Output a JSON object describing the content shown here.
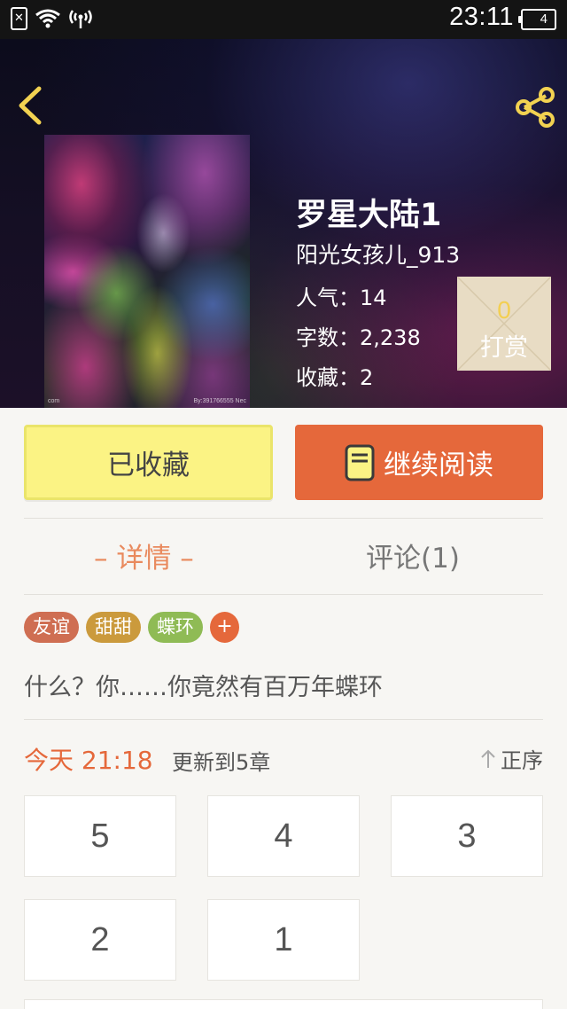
{
  "status_bar": {
    "time": "23:11",
    "battery": "4",
    "sim_icon": "no-sim-icon",
    "wifi_icon": "wifi-icon",
    "hotspot_icon": "hotspot-icon"
  },
  "header": {
    "back_icon": "chevron-left-icon",
    "share_icon": "share-icon",
    "icon_color": "#f2d251"
  },
  "book": {
    "title": "罗星大陆1",
    "author": "阳光女孩儿_913",
    "stats": {
      "popularity_label": "人气：",
      "popularity_value": "14",
      "words_label": "字数：",
      "words_value": "2,238",
      "favorites_label": "收藏：",
      "favorites_value": "2"
    },
    "tip": {
      "count": "0",
      "label": "打赏"
    }
  },
  "actions": {
    "favorite_label": "已收藏",
    "read_label": "继续阅读",
    "read_icon": "book-icon",
    "accent_color": "#e5683b"
  },
  "tabs": [
    {
      "label": "– 详情 –",
      "active": true
    },
    {
      "label": "评论(1)",
      "active": false
    }
  ],
  "tags": [
    {
      "label": "友谊",
      "color": "#cf6e52"
    },
    {
      "label": "甜甜",
      "color": "#cb9a3c"
    },
    {
      "label": "蝶环",
      "color": "#8fbb55"
    }
  ],
  "tag_add": {
    "label": "+",
    "color": "#e5683b"
  },
  "summary": "什么？你……你竟然有百万年蝶环",
  "chapters_header": {
    "date": "今天 21:18",
    "update_text": "更新到5章",
    "sort_label": "正序",
    "sort_icon": "arrow-up-icon"
  },
  "chapters": [
    "5",
    "4",
    "3",
    "2",
    "1"
  ]
}
